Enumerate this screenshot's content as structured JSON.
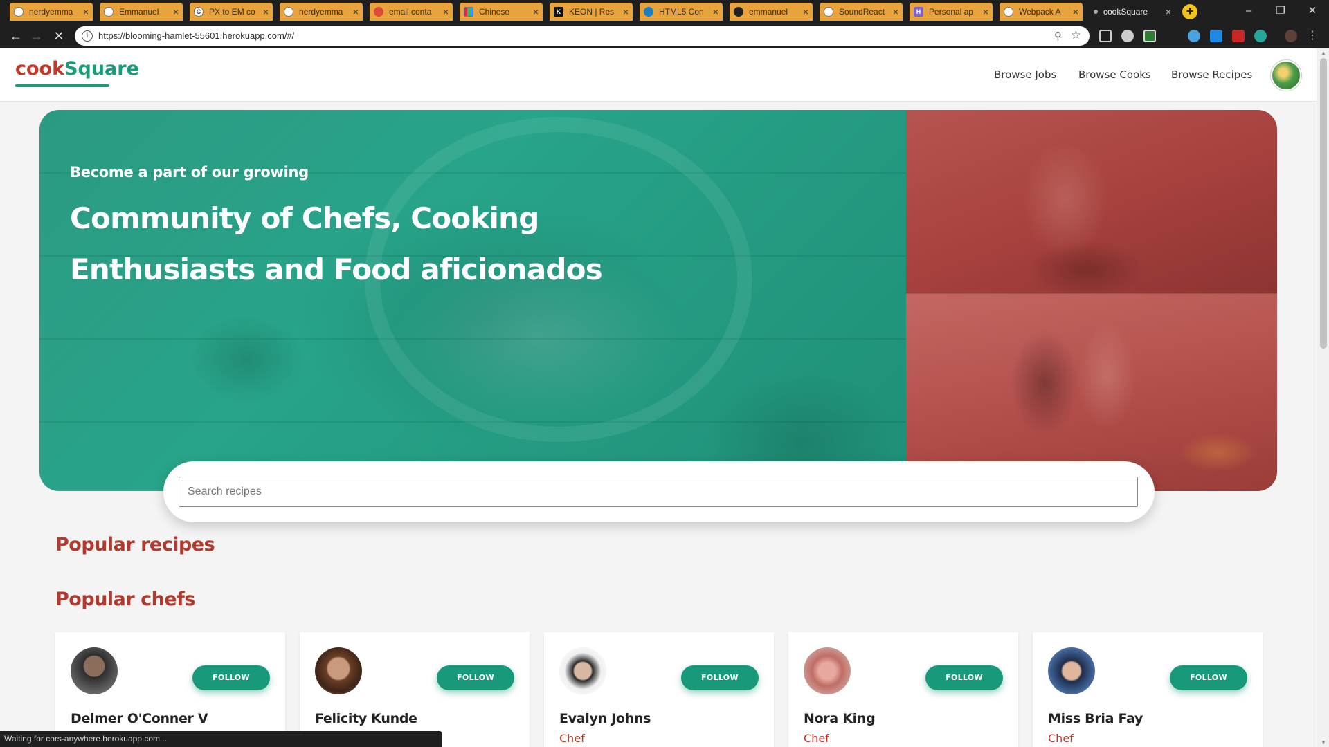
{
  "browser": {
    "tabs": [
      {
        "title": "nerdyemma",
        "favicon": "globe-icon"
      },
      {
        "title": "Emmanuel",
        "favicon": "chrome-icon"
      },
      {
        "title": "PX to EM co",
        "favicon": "c-icon"
      },
      {
        "title": "nerdyemma",
        "favicon": "globe-icon"
      },
      {
        "title": "email conta",
        "favicon": "pinterest-icon"
      },
      {
        "title": "Chinese",
        "favicon": "grid-icon"
      },
      {
        "title": "KEON | Res",
        "favicon": "k-icon"
      },
      {
        "title": "HTML5 Con",
        "favicon": "circle-icon"
      },
      {
        "title": "emmanuel",
        "favicon": "github-icon"
      },
      {
        "title": "SoundReact",
        "favicon": "globe-icon"
      },
      {
        "title": "Personal ap",
        "favicon": "h-icon"
      },
      {
        "title": "Webpack A",
        "favicon": "globe-icon"
      },
      {
        "title": "cookSquare",
        "favicon": "dot-icon"
      }
    ],
    "url": "https://blooming-hamlet-55601.herokuapp.com/#/",
    "status": "Waiting for cors-anywhere.herokuapp.com..."
  },
  "site": {
    "logo_part1": "cook",
    "logo_part2": "Square",
    "nav": [
      "Browse Jobs",
      "Browse Cooks",
      "Browse Recipes"
    ]
  },
  "hero": {
    "subtitle": "Become a part of our growing",
    "title": "Community of Chefs, Cooking Enthusiasts and Food aficionados"
  },
  "search": {
    "placeholder": "Search recipes"
  },
  "sections": {
    "recipes": "Popular recipes",
    "chefs": "Popular chefs"
  },
  "chefs": [
    {
      "name": "Delmer O'Conner V",
      "role": "",
      "follow": "FOLLOW"
    },
    {
      "name": "Felicity Kunde",
      "role": "",
      "follow": "FOLLOW"
    },
    {
      "name": "Evalyn Johns",
      "role": "Chef",
      "follow": "FOLLOW"
    },
    {
      "name": "Nora King",
      "role": "Chef",
      "follow": "FOLLOW"
    },
    {
      "name": "Miss Bria Fay",
      "role": "Chef",
      "follow": "FOLLOW"
    }
  ],
  "colors": {
    "brand_green": "#1a9b7b",
    "brand_red": "#c0392b",
    "tab_orange": "#e8a33d"
  }
}
